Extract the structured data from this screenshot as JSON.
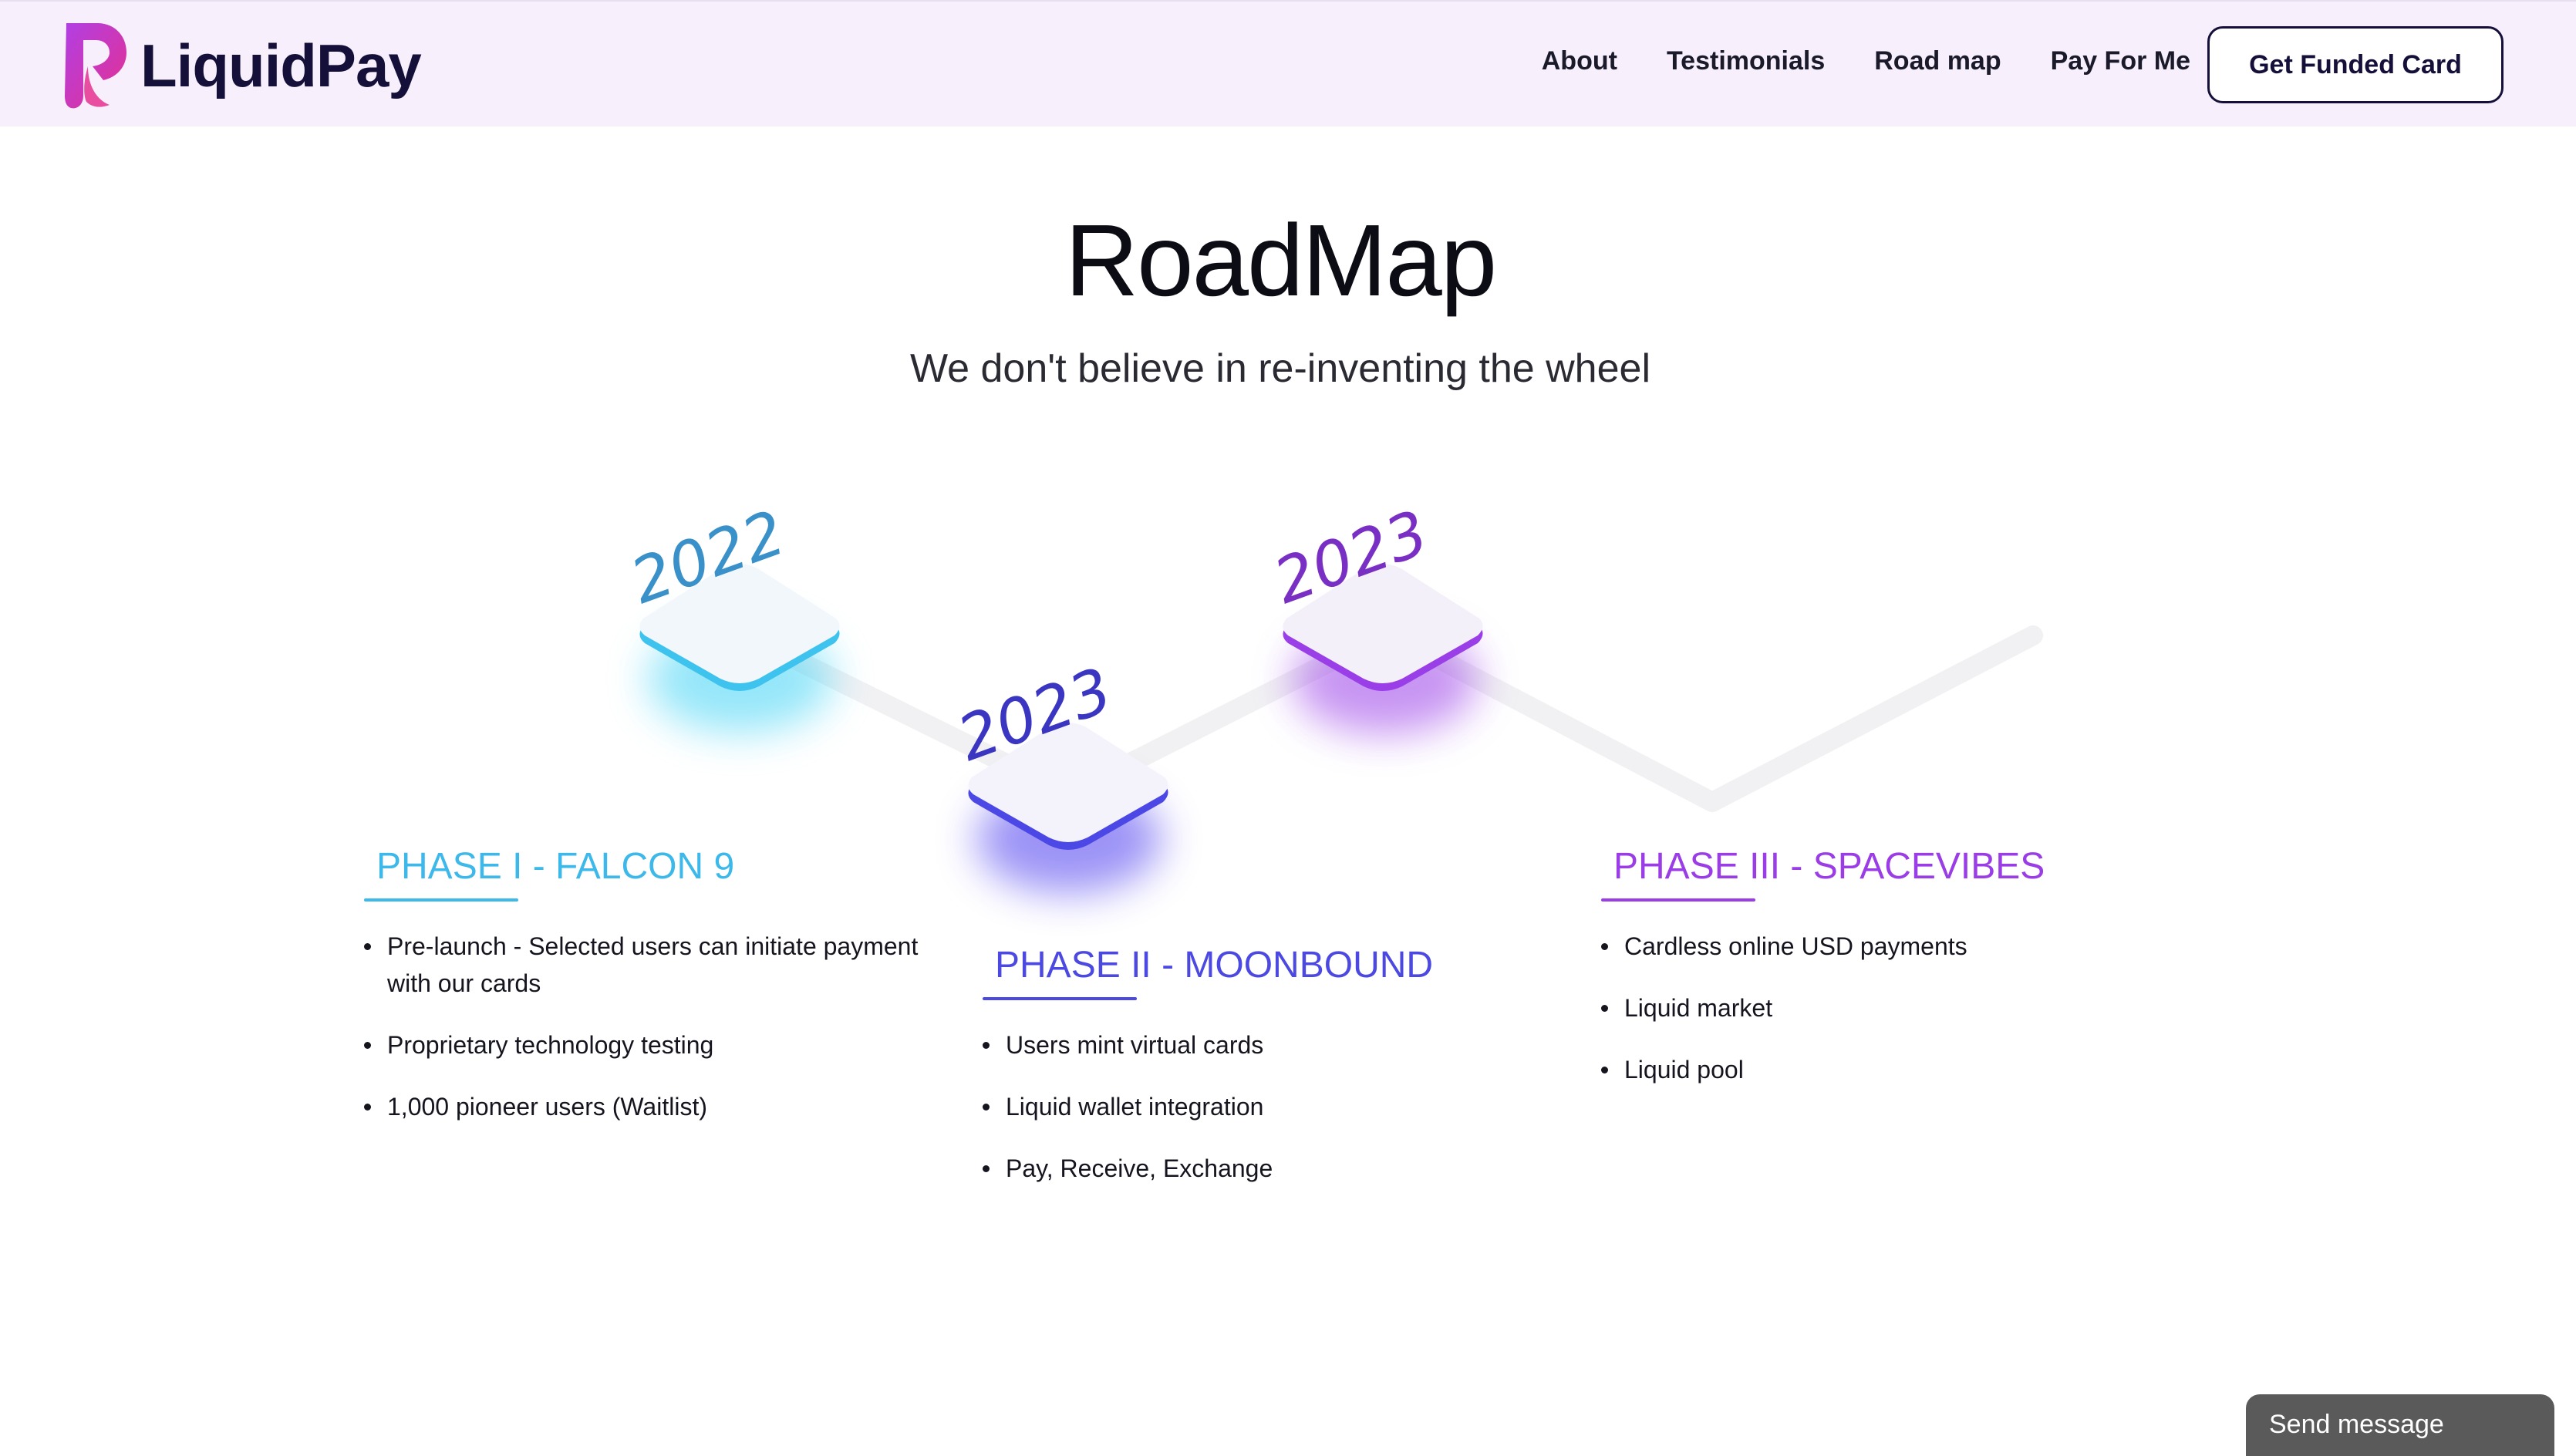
{
  "brand": {
    "name": "LiquidPay"
  },
  "nav": {
    "links": [
      "About",
      "Testimonials",
      "Road map",
      "Pay For Me"
    ],
    "cta": "Get Funded Card"
  },
  "hero": {
    "title": "RoadMap",
    "subtitle": "We don't believe in re-inventing the wheel"
  },
  "milestones": [
    {
      "year": "2022",
      "color": "#3ec3ee"
    },
    {
      "year": "2023",
      "color": "#4b48e6"
    },
    {
      "year": "2023",
      "color": "#9a3ee8"
    }
  ],
  "phases": [
    {
      "title": "PHASE I - FALCON 9",
      "color": "#3cb8ea",
      "items": [
        "Pre-launch - Selected users can initiate payment with our cards",
        "Proprietary technology testing",
        "1,000 pioneer users (Waitlist)"
      ]
    },
    {
      "title": "PHASE II - MOONBOUND",
      "color": "#4c48e2",
      "items": [
        "Users mint virtual cards",
        "Liquid wallet integration",
        "Pay, Receive, Exchange"
      ]
    },
    {
      "title": "PHASE III - SPACEVIBES",
      "color": "#9b3de6",
      "items": [
        "Cardless online USD payments",
        "Liquid market",
        "Liquid pool"
      ]
    }
  ],
  "chat": {
    "label": "Send message"
  }
}
